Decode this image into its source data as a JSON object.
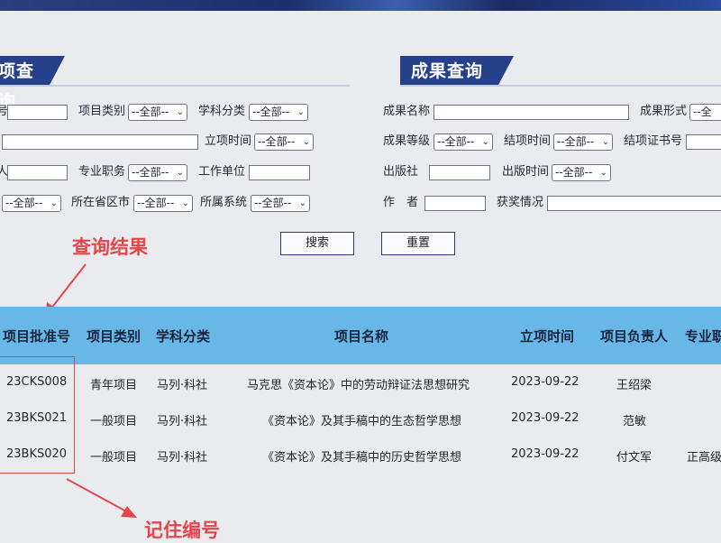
{
  "project_query": {
    "title": "项查询",
    "row1": {
      "label_a": "号",
      "label_b": "项目类别",
      "select_b": "--全部--",
      "label_c": "学科分类",
      "select_c": "--全部--"
    },
    "row2": {
      "label_time": "立项时间",
      "select_time": "--全部--"
    },
    "row3": {
      "label_a": "人",
      "label_b": "专业职务",
      "select_b": "--全部--",
      "label_c": "工作单位"
    },
    "row4": {
      "select_a": "--全部--",
      "label_b": "所在省区市",
      "select_b": "--全部--",
      "label_c": "所属系统",
      "select_c": "--全部--"
    }
  },
  "result_query": {
    "title": "成果查询",
    "row1": {
      "label_a": "成果名称",
      "label_b": "成果形式",
      "select_b": "--全"
    },
    "row2": {
      "label_a": "成果等级",
      "select_a": "--全部--",
      "label_b": "结项时间",
      "select_b": "--全部--",
      "label_c": "结项证书号"
    },
    "row3": {
      "label_a": "出版社",
      "label_b": "出版时间",
      "select_b": "--全部--"
    },
    "row4": {
      "label_a": "作　者",
      "label_b": "获奖情况"
    }
  },
  "buttons": {
    "search": "搜索",
    "reset": "重置"
  },
  "annotations": {
    "results": "查询结果",
    "remember": "记住编号"
  },
  "table": {
    "headers": [
      "项目批准号",
      "项目类别",
      "学科分类",
      "项目名称",
      "立项时间",
      "项目负责人",
      "专业职"
    ],
    "rows": [
      [
        "23CKS008",
        "青年项目",
        "马列·科社",
        "马克思《资本论》中的劳动辩证法思想研究",
        "2023-09-22",
        "王绍梁",
        ""
      ],
      [
        "23BKS021",
        "一般项目",
        "马列·科社",
        "《资本论》及其手稿中的生态哲学思想",
        "2023-09-22",
        "范敏",
        ""
      ],
      [
        "23BKS020",
        "一般项目",
        "马列·科社",
        "《资本论》及其手稿中的历史哲学思想",
        "2023-09-22",
        "付文军",
        "正高级"
      ]
    ]
  },
  "colors": {
    "header_bg": "#67b8e6",
    "title_bg": "#27408b",
    "annotation": "#e2474b"
  }
}
